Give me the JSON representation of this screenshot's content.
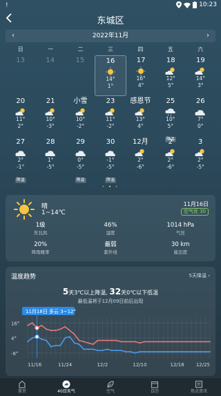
{
  "statusbar": {
    "left": "! ",
    "time": "10:23"
  },
  "header": {
    "title": "东城区"
  },
  "calendar": {
    "month_label": "2022年11月",
    "weekdays": [
      "日",
      "一",
      "二",
      "三",
      "四",
      "五",
      "六"
    ],
    "rows": [
      [
        {
          "day": "13",
          "past": true
        },
        {
          "day": "14",
          "past": true
        },
        {
          "day": "15",
          "past": true
        },
        {
          "day": "16",
          "icon": "sun-icon",
          "hi": "14°",
          "lo": "1°",
          "selected": true
        },
        {
          "day": "17",
          "icon": "sun-icon",
          "hi": "16°",
          "lo": "4°"
        },
        {
          "day": "18",
          "icon": "cloud-sun-icon",
          "hi": "12°",
          "lo": "5°"
        },
        {
          "day": "19",
          "icon": "cloud-sun-icon",
          "hi": "14°",
          "lo": "3°"
        }
      ],
      [
        {
          "day": "20",
          "icon": "cloud-sun-icon",
          "hi": "11°",
          "lo": "2°"
        },
        {
          "day": "21",
          "icon": "cloud-sun-icon",
          "hi": "10°",
          "lo": "-3°"
        },
        {
          "day": "小雪",
          "icon": "cloud-sun-icon",
          "hi": "10°",
          "lo": "-2°"
        },
        {
          "day": "23",
          "icon": "cloud-sun-icon",
          "hi": "11°",
          "lo": "-2°"
        },
        {
          "day": "感恩节",
          "icon": "cloud-sun-icon",
          "hi": "13°",
          "lo": "4°"
        },
        {
          "day": "25",
          "icon": "cloud-rain-icon",
          "hi": "10°",
          "lo": "5°",
          "badge": "降温"
        },
        {
          "day": "26",
          "icon": "cloud-icon",
          "hi": "7°",
          "lo": "0°"
        }
      ],
      [
        {
          "day": "27",
          "icon": "cloud-icon",
          "hi": "2°",
          "lo": "-1°",
          "badge": "降温"
        },
        {
          "day": "28",
          "icon": "cloud-icon",
          "hi": "1°",
          "lo": "-5°"
        },
        {
          "day": "29",
          "icon": "cloud-icon",
          "hi": "0°",
          "lo": "-5°",
          "badge": "降温"
        },
        {
          "day": "30",
          "icon": "cloud-icon",
          "hi": "-1°",
          "lo": "-5°",
          "badge": "降温"
        },
        {
          "day": "12月",
          "icon": "cloud-sun-icon",
          "hi": "2°",
          "lo": "-6°"
        },
        {
          "day": "2",
          "icon": "cloud-sun-icon",
          "hi": "2°",
          "lo": "-6°"
        },
        {
          "day": "3",
          "icon": "cloud-sun-icon",
          "hi": "2°",
          "lo": "-5°"
        }
      ]
    ],
    "pager_dots": [
      "•",
      "•",
      "•"
    ]
  },
  "today": {
    "condition": "晴",
    "range": "1~14℃",
    "date": "11月16日",
    "aqi": "空气优 30",
    "stats": [
      [
        {
          "value": "1级",
          "label": "东北风"
        },
        {
          "value": "46%",
          "label": "湿度"
        },
        {
          "value": "1014 hPa",
          "label": "气压"
        }
      ],
      [
        {
          "value": "20%",
          "label": "降雨概率"
        },
        {
          "value": "最弱",
          "label": "紫外线"
        },
        {
          "value": "30 km",
          "label": "能见度"
        }
      ]
    ]
  },
  "trend": {
    "title": "温度趋势",
    "link": "5天降温 ›",
    "summary_a_num": "5",
    "summary_a_text": "天3℃以上降温, ",
    "summary_b_num": "32",
    "summary_b_text": "天0℃以下低温",
    "subtitle": "最低温将于12月09日前后出现",
    "tooltip": "11月18日 多云 3~12°",
    "chart_data": {
      "type": "line",
      "x": [
        "11/16",
        "11/17",
        "11/18",
        "11/19",
        "11/20",
        "11/21",
        "11/22",
        "11/23",
        "11/24",
        "11/25",
        "11/26",
        "11/27",
        "11/28",
        "11/29",
        "11/30",
        "12/01",
        "12/02",
        "12/03",
        "12/04",
        "12/05",
        "12/06",
        "12/07",
        "12/08",
        "12/09",
        "12/10",
        "12/11",
        "12/12",
        "12/13",
        "12/14",
        "12/15",
        "12/16",
        "12/17",
        "12/18",
        "12/19",
        "12/20",
        "12/21",
        "12/22",
        "12/23",
        "12/24",
        "12/25"
      ],
      "x_tick_labels": [
        "11/16",
        "11/24",
        "12/2",
        "12/10",
        "12/18",
        "12/25"
      ],
      "y_tick_labels": [
        "16°",
        "4°",
        "-8°"
      ],
      "ylim": [
        -12,
        20
      ],
      "series": [
        {
          "color": "#e8787a",
          "values": [
            14,
            16,
            12,
            14,
            11,
            10,
            10,
            11,
            13,
            10,
            7,
            2,
            1,
            0,
            -1,
            2,
            2,
            2,
            2,
            2,
            1,
            1,
            1,
            1,
            0,
            1,
            1,
            1,
            1,
            1,
            1,
            1,
            1,
            1,
            1,
            1,
            1,
            1,
            1,
            1
          ]
        },
        {
          "color": "#4a9be8",
          "values": [
            1,
            4,
            5,
            3,
            2,
            -3,
            -2,
            -2,
            4,
            5,
            0,
            -1,
            -5,
            -5,
            -5,
            -6,
            -6,
            -5,
            -6,
            -6,
            -6,
            -7,
            -7,
            -8,
            -7,
            -7,
            -7,
            -7,
            -7,
            -7,
            -7,
            -7,
            -7,
            -7,
            -7,
            -7,
            -7,
            -7,
            -7,
            -7
          ]
        }
      ]
    }
  },
  "nav": [
    {
      "label": "首页",
      "icon": "home-icon"
    },
    {
      "label": "40日天气",
      "icon": "forecast-40-icon",
      "active": true
    },
    {
      "label": "空气",
      "icon": "leaf-icon"
    },
    {
      "label": "日历",
      "icon": "calendar-icon"
    },
    {
      "label": "热点资讯",
      "icon": "news-icon"
    }
  ],
  "colors": {
    "high": "#e8787a",
    "low": "#4a9be8",
    "sun": "#f5c542",
    "accent": "#2b8be6"
  }
}
